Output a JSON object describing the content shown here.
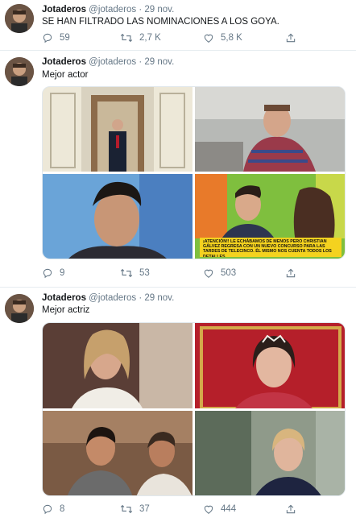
{
  "tweets": [
    {
      "name": "Jotaderos",
      "handle": "@jotaderos",
      "dot": "·",
      "date": "29 nov.",
      "text": "SE HAN FILTRADO LAS NOMINACIONES A LOS GOYA.",
      "replies": "59",
      "retweets": "2,7 K",
      "likes": "5,8 K"
    },
    {
      "name": "Jotaderos",
      "handle": "@jotaderos",
      "dot": "·",
      "date": "29 nov.",
      "text": "Mejor actor",
      "replies": "9",
      "retweets": "53",
      "likes": "503",
      "banner": "¡ATENCIÓN!! LE ECHÁBAMOS DE MENOS PERO CHRISTIAN GÁLVEZ REGRESA CON UN NUEVO CONCURSO PARA LAS TARDES DE TELECINCO. ÉL MISMO NOS CUENTA TODOS LOS DETALLES"
    },
    {
      "name": "Jotaderos",
      "handle": "@jotaderos",
      "dot": "·",
      "date": "29 nov.",
      "text": "Mejor actriz",
      "replies": "8",
      "retweets": "37",
      "likes": "444"
    }
  ],
  "icons": {
    "reply": "reply-icon",
    "retweet": "retweet-icon",
    "like": "heart-icon",
    "share": "share-icon"
  },
  "colors": {
    "text": "#14171a",
    "muted": "#657786",
    "divider": "#e6ecf0"
  }
}
